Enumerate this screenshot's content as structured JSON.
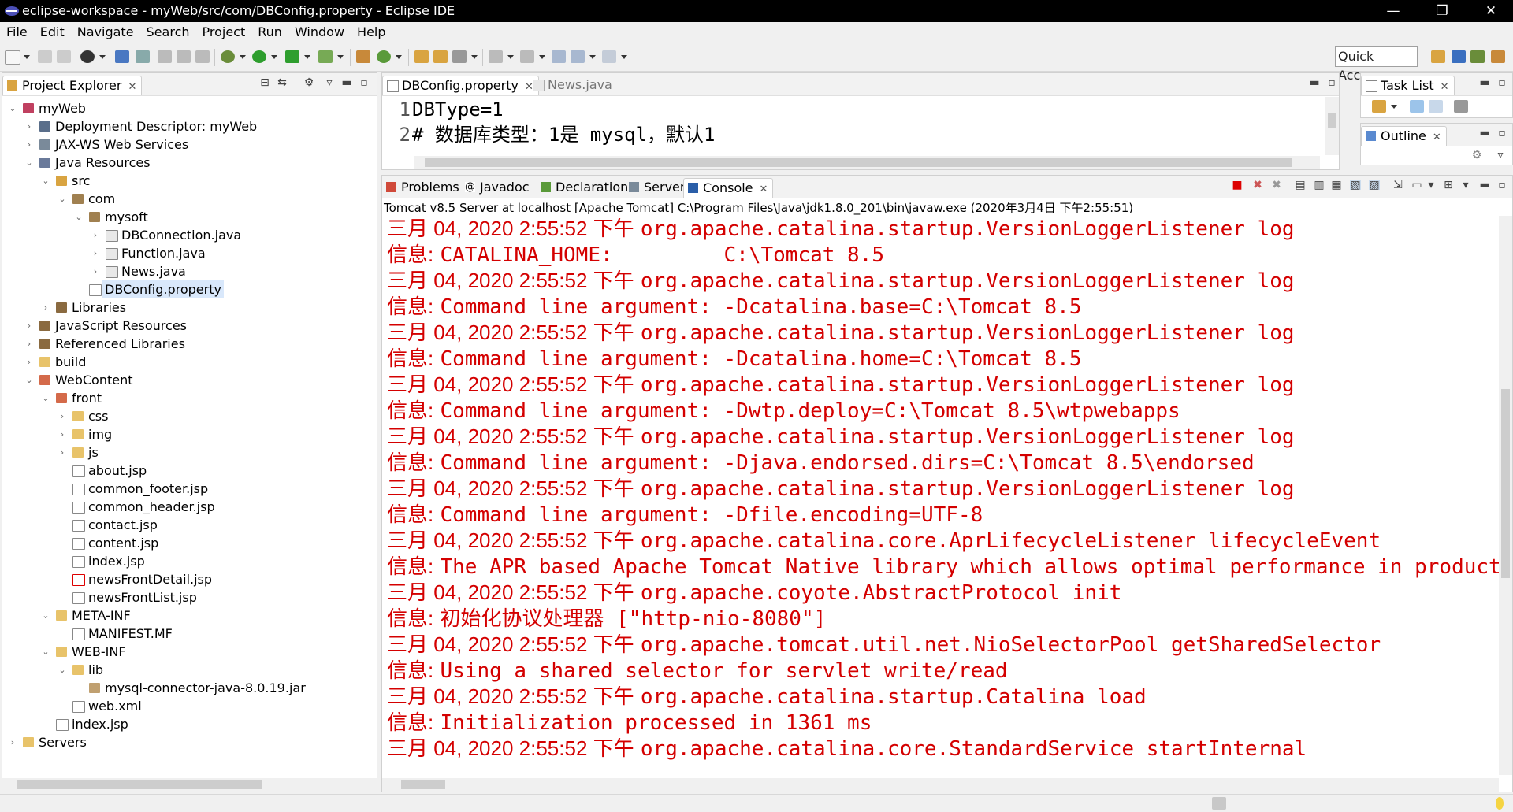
{
  "window": {
    "title": "eclipse-workspace - myWeb/src/com/DBConfig.property - Eclipse IDE",
    "minimize": "—",
    "restore": "❐",
    "close": "✕"
  },
  "menu": [
    "File",
    "Edit",
    "Navigate",
    "Search",
    "Project",
    "Run",
    "Window",
    "Help"
  ],
  "toolbar": {
    "quick_access": "Quick Access"
  },
  "project_explorer": {
    "tab_label": "Project Explorer",
    "tree": [
      {
        "label": "myWeb",
        "depth": 0,
        "expanded": true,
        "icon": "web-project-icon"
      },
      {
        "label": "Deployment Descriptor: myWeb",
        "depth": 1,
        "expanded": false,
        "icon": "deployment-descriptor-icon"
      },
      {
        "label": "JAX-WS Web Services",
        "depth": 1,
        "expanded": false,
        "icon": "web-services-icon"
      },
      {
        "label": "Java Resources",
        "depth": 1,
        "expanded": true,
        "icon": "java-resources-icon"
      },
      {
        "label": "src",
        "depth": 2,
        "expanded": true,
        "icon": "source-folder-icon"
      },
      {
        "label": "com",
        "depth": 3,
        "expanded": true,
        "icon": "package-icon"
      },
      {
        "label": "mysoft",
        "depth": 4,
        "expanded": true,
        "icon": "package-icon"
      },
      {
        "label": "DBConnection.java",
        "depth": 5,
        "expanded": false,
        "icon": "java-file-icon"
      },
      {
        "label": "Function.java",
        "depth": 5,
        "expanded": false,
        "icon": "java-file-icon"
      },
      {
        "label": "News.java",
        "depth": 5,
        "expanded": false,
        "icon": "java-file-icon"
      },
      {
        "label": "DBConfig.property",
        "depth": 4,
        "expanded": null,
        "icon": "text-file-icon",
        "selected": true
      },
      {
        "label": "Libraries",
        "depth": 2,
        "expanded": false,
        "icon": "libraries-icon"
      },
      {
        "label": "JavaScript Resources",
        "depth": 1,
        "expanded": false,
        "icon": "javascript-resources-icon"
      },
      {
        "label": "Referenced Libraries",
        "depth": 1,
        "expanded": false,
        "icon": "libraries-icon"
      },
      {
        "label": "build",
        "depth": 1,
        "expanded": false,
        "icon": "folder-icon"
      },
      {
        "label": "WebContent",
        "depth": 1,
        "expanded": true,
        "icon": "web-folder-icon"
      },
      {
        "label": "front",
        "depth": 2,
        "expanded": true,
        "icon": "web-folder-icon"
      },
      {
        "label": "css",
        "depth": 3,
        "expanded": false,
        "icon": "folder-icon"
      },
      {
        "label": "img",
        "depth": 3,
        "expanded": false,
        "icon": "folder-icon"
      },
      {
        "label": "js",
        "depth": 3,
        "expanded": false,
        "icon": "folder-icon"
      },
      {
        "label": "about.jsp",
        "depth": 3,
        "expanded": null,
        "icon": "jsp-file-icon"
      },
      {
        "label": "common_footer.jsp",
        "depth": 3,
        "expanded": null,
        "icon": "jsp-file-icon"
      },
      {
        "label": "common_header.jsp",
        "depth": 3,
        "expanded": null,
        "icon": "jsp-file-icon"
      },
      {
        "label": "contact.jsp",
        "depth": 3,
        "expanded": null,
        "icon": "jsp-file-icon"
      },
      {
        "label": "content.jsp",
        "depth": 3,
        "expanded": null,
        "icon": "jsp-file-icon"
      },
      {
        "label": "index.jsp",
        "depth": 3,
        "expanded": null,
        "icon": "jsp-file-icon"
      },
      {
        "label": "newsFrontDetail.jsp",
        "depth": 3,
        "expanded": null,
        "icon": "jsp-error-file-icon"
      },
      {
        "label": "newsFrontList.jsp",
        "depth": 3,
        "expanded": null,
        "icon": "jsp-file-icon"
      },
      {
        "label": "META-INF",
        "depth": 2,
        "expanded": true,
        "icon": "folder-icon"
      },
      {
        "label": "MANIFEST.MF",
        "depth": 3,
        "expanded": null,
        "icon": "text-file-icon"
      },
      {
        "label": "WEB-INF",
        "depth": 2,
        "expanded": true,
        "icon": "folder-icon"
      },
      {
        "label": "lib",
        "depth": 3,
        "expanded": true,
        "icon": "folder-icon"
      },
      {
        "label": "mysql-connector-java-8.0.19.jar",
        "depth": 4,
        "expanded": null,
        "icon": "jar-file-icon"
      },
      {
        "label": "web.xml",
        "depth": 3,
        "expanded": null,
        "icon": "xml-file-icon"
      },
      {
        "label": "index.jsp",
        "depth": 2,
        "expanded": null,
        "icon": "jsp-file-icon"
      },
      {
        "label": "Servers",
        "depth": 0,
        "expanded": false,
        "icon": "servers-folder-icon"
      }
    ]
  },
  "editor": {
    "tabs": [
      {
        "label": "DBConfig.property",
        "active": true
      },
      {
        "label": "News.java",
        "active": false
      }
    ],
    "lines": [
      {
        "no": "1",
        "text": "DBType=1"
      },
      {
        "no": "2",
        "text": "# 数据库类型：1是 mysql，默认1"
      }
    ]
  },
  "bottom_panel": {
    "tabs": [
      {
        "label": "Problems",
        "active": false
      },
      {
        "label": "Javadoc",
        "active": false
      },
      {
        "label": "Declaration",
        "active": false
      },
      {
        "label": "Servers",
        "active": false
      },
      {
        "label": "Console",
        "active": true
      }
    ],
    "console_title": "Tomcat v8.5 Server at localhost [Apache Tomcat] C:\\Program Files\\Java\\jdk1.8.0_201\\bin\\javaw.exe (2020年3月4日 下午2:55:51)",
    "lines": [
      {
        "prefix": "三月 04, 2020 2:55:52 下午",
        "text": "org.apache.catalina.startup.VersionLoggerListener log"
      },
      {
        "prefix": "信息:",
        "text": "CATALINA_HOME:         C:\\Tomcat 8.5"
      },
      {
        "prefix": "三月 04, 2020 2:55:52 下午",
        "text": "org.apache.catalina.startup.VersionLoggerListener log"
      },
      {
        "prefix": "信息:",
        "text": "Command line argument: -Dcatalina.base=C:\\Tomcat 8.5"
      },
      {
        "prefix": "三月 04, 2020 2:55:52 下午",
        "text": "org.apache.catalina.startup.VersionLoggerListener log"
      },
      {
        "prefix": "信息:",
        "text": "Command line argument: -Dcatalina.home=C:\\Tomcat 8.5"
      },
      {
        "prefix": "三月 04, 2020 2:55:52 下午",
        "text": "org.apache.catalina.startup.VersionLoggerListener log"
      },
      {
        "prefix": "信息:",
        "text": "Command line argument: -Dwtp.deploy=C:\\Tomcat 8.5\\wtpwebapps"
      },
      {
        "prefix": "三月 04, 2020 2:55:52 下午",
        "text": "org.apache.catalina.startup.VersionLoggerListener log"
      },
      {
        "prefix": "信息:",
        "text": "Command line argument: -Djava.endorsed.dirs=C:\\Tomcat 8.5\\endorsed"
      },
      {
        "prefix": "三月 04, 2020 2:55:52 下午",
        "text": "org.apache.catalina.startup.VersionLoggerListener log"
      },
      {
        "prefix": "信息:",
        "text": "Command line argument: -Dfile.encoding=UTF-8"
      },
      {
        "prefix": "三月 04, 2020 2:55:52 下午",
        "text": "org.apache.catalina.core.AprLifecycleListener lifecycleEvent"
      },
      {
        "prefix": "信息:",
        "text": "The APR based Apache Tomcat Native library which allows optimal performance in production"
      },
      {
        "prefix": "三月 04, 2020 2:55:52 下午",
        "text": "org.apache.coyote.AbstractProtocol init"
      },
      {
        "prefix": "信息:",
        "text": "初始化协议处理器 [\"http-nio-8080\"]"
      },
      {
        "prefix": "三月 04, 2020 2:55:52 下午",
        "text": "org.apache.tomcat.util.net.NioSelectorPool getSharedSelector"
      },
      {
        "prefix": "信息:",
        "text": "Using a shared selector for servlet write/read"
      },
      {
        "prefix": "三月 04, 2020 2:55:52 下午",
        "text": "org.apache.catalina.startup.Catalina load"
      },
      {
        "prefix": "信息:",
        "text": "Initialization processed in 1361 ms"
      },
      {
        "prefix": "三月 04, 2020 2:55:52 下午",
        "text": "org.apache.catalina.core.StandardService startInternal"
      }
    ]
  },
  "right_panels": {
    "task_list": "Task List",
    "outline": "Outline"
  },
  "colors": {
    "console_text": "#d40000",
    "selection": "#d9e8fb",
    "title_bar": "#000000"
  }
}
